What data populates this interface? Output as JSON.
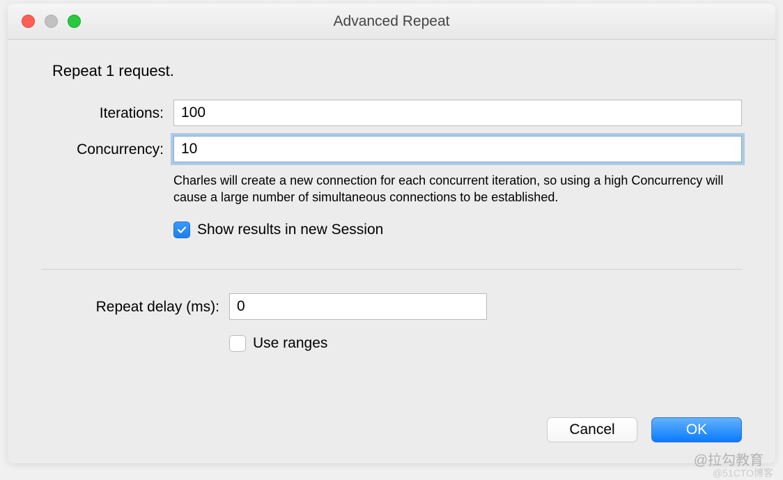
{
  "window": {
    "title": "Advanced Repeat"
  },
  "form": {
    "heading": "Repeat 1 request.",
    "iterations": {
      "label": "Iterations:",
      "value": "100"
    },
    "concurrency": {
      "label": "Concurrency:",
      "value": "10",
      "help": "Charles will create a new connection for each concurrent iteration, so using a high Concurrency will cause a large number of simultaneous connections to be established."
    },
    "show_results": {
      "label": "Show results in new Session",
      "checked": true
    },
    "repeat_delay": {
      "label": "Repeat delay (ms):",
      "value": "0"
    },
    "use_ranges": {
      "label": "Use ranges",
      "checked": false
    }
  },
  "buttons": {
    "cancel": "Cancel",
    "ok": "OK"
  },
  "watermark": "@拉勾教育",
  "watermark2": "@51CTO博客"
}
